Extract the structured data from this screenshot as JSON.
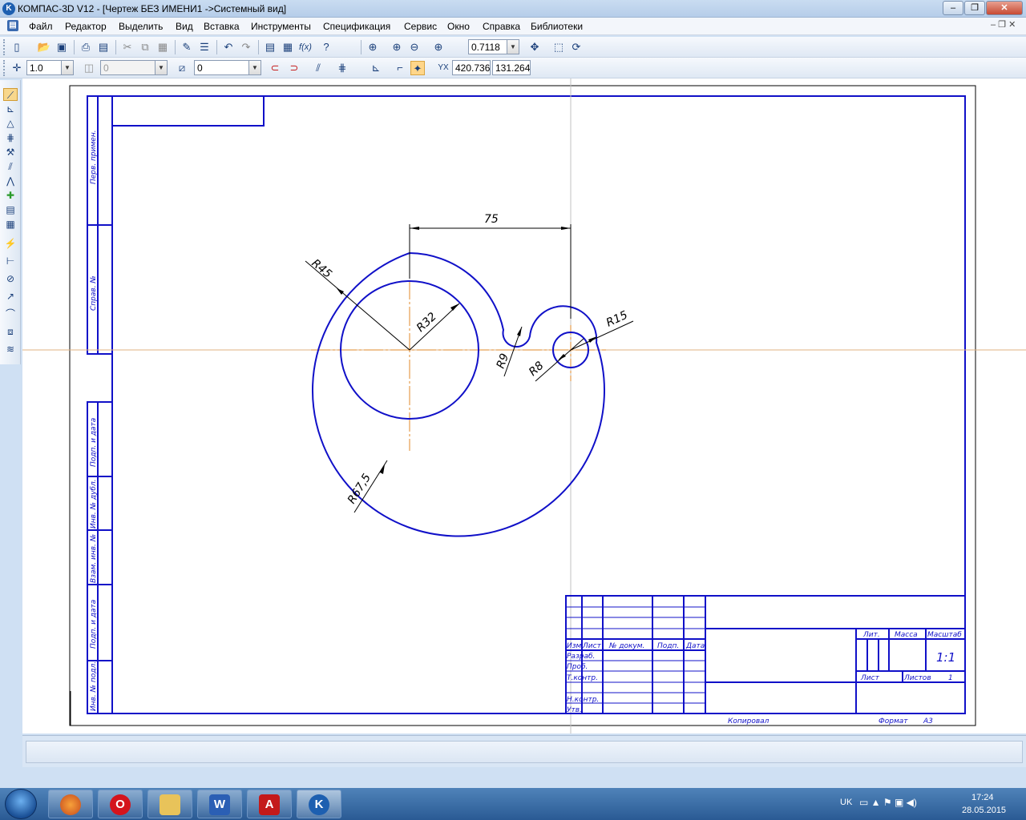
{
  "window": {
    "title": "КОМПАС-3D V12 - [Чертеж БЕЗ ИМЕНИ1 ->Системный вид]",
    "app_icon": "kompas-logo-icon",
    "min_label": "–",
    "max_label": "❐",
    "close_label": "✕"
  },
  "menu": {
    "items": [
      "Файл",
      "Редактор",
      "Выделить",
      "Вид",
      "Вставка",
      "Инструменты",
      "Спецификация",
      "Сервис",
      "Окно",
      "Справка",
      "Библиотеки"
    ]
  },
  "toolbar1": {
    "zoom_value": "0.7118"
  },
  "toolbar2": {
    "step_value": "1.0",
    "layer_value": "0",
    "style_value": "0",
    "x_label": "X",
    "y_label": "Y",
    "x_coord": "420.736",
    "y_coord": "131.264"
  },
  "drawing": {
    "dim_75": "75",
    "dim_r45": "R45",
    "dim_r32": "R32",
    "dim_r9": "R9",
    "dim_r8": "R8",
    "dim_r15": "R15",
    "dim_r675": "R67,5",
    "side_labels": [
      "Перв. примен.",
      "Справ. №",
      "Подп. и дата",
      "Инв. № дубл.",
      "Взам. инв. №",
      "Подп. и дата",
      "Инв. № подл."
    ],
    "title_block": {
      "izm": "Изм.",
      "list": "Лист",
      "ndokum": "№ докум.",
      "podp": "Подп.",
      "data": "Дата",
      "razrab": "Разраб.",
      "prob": "Проб.",
      "tkontr": "Т.контр.",
      "nkontr": "Н.контр.",
      "utv": "Утв.",
      "lit": "Лит.",
      "massa": "Масса",
      "masshtab": "Масштаб",
      "scale": "1:1",
      "list2": "Лист",
      "listov": "Листов",
      "listov_val": "1",
      "kopiroval": "Копировал",
      "format": "Формат",
      "format_val": "A3"
    }
  },
  "taskbar": {
    "lang": "UK",
    "time": "17:24",
    "date": "28.05.2015"
  },
  "colors": {
    "drawing_line": "#1010c8",
    "axis_line": "#e08a2a",
    "titlebar": "#c9dcf1"
  }
}
